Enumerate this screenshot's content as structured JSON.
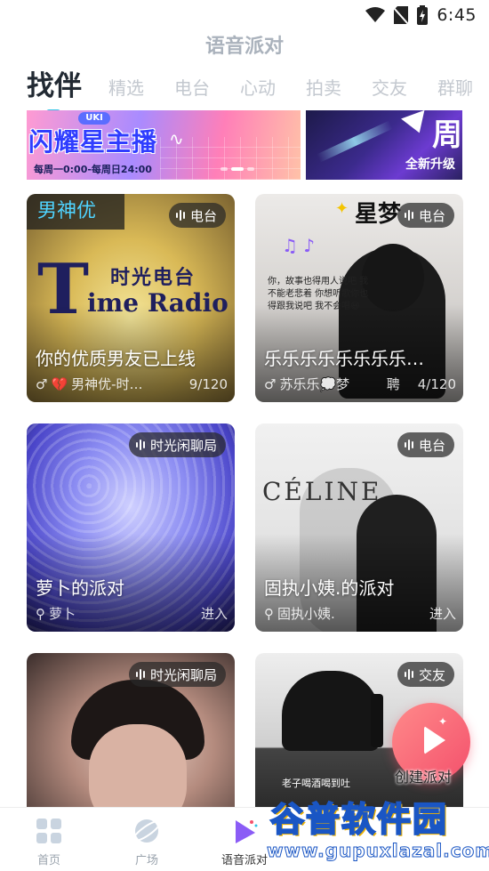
{
  "status_bar": {
    "time": "6:45"
  },
  "app_title": "语音派对",
  "tabs": [
    {
      "label": "找伴",
      "active": true
    },
    {
      "label": "精选"
    },
    {
      "label": "电台"
    },
    {
      "label": "心动"
    },
    {
      "label": "拍卖"
    },
    {
      "label": "交友"
    },
    {
      "label": "群聊"
    }
  ],
  "banner": {
    "left": {
      "brand": "UKI",
      "title": "闪耀星主播",
      "schedule": "每周一0:00-每周日24:00"
    },
    "right": {
      "char": "周",
      "text": "全新升级"
    }
  },
  "cards": [
    {
      "category": "电台",
      "cover_name": "男神优",
      "cover_text_cn": "时光电台",
      "cover_text_a": "T",
      "cover_text_b": "ime Radio",
      "title": "你的优质男友已上线",
      "host": "男神优-时…",
      "gender_icon": "male-icon",
      "count": "9/120"
    },
    {
      "category": "电台",
      "cover_text": "星梦",
      "title": "乐乐乐乐乐乐乐乐…",
      "host": "苏乐乐💭梦",
      "tag": "聘",
      "gender_icon": "male-icon",
      "count": "4/120",
      "scribble": "你，故事也得用人说吧 我不能老悲着 你想听歌你也得跟我说吧 我不会唱😃"
    },
    {
      "category": "时光闲聊局",
      "title": "萝卜的派对",
      "host": "萝卜",
      "action": "进入"
    },
    {
      "category": "电台",
      "cover_text": "CÉLINE",
      "title": "固执小姨.的派对",
      "host": "固执小姨.",
      "action": "进入"
    },
    {
      "category": "时光闲聊局"
    },
    {
      "category": "交友",
      "caption": "老子喝酒喝到吐"
    }
  ],
  "fab": {
    "label": "创建派对"
  },
  "bottom_nav": [
    {
      "label": "首页",
      "icon": "home-grid-icon"
    },
    {
      "label": "广场",
      "icon": "planet-icon"
    },
    {
      "label": "语音派对",
      "icon": "voice-party-icon",
      "active": true
    }
  ],
  "watermark": {
    "logo": "谷普软件园",
    "url": "www.gupuxlazal.com"
  },
  "colors": {
    "accent": "#2ec4e6",
    "fab": "#f4516c",
    "active_text": "#222a33",
    "inactive_text": "#c3c8cf"
  }
}
